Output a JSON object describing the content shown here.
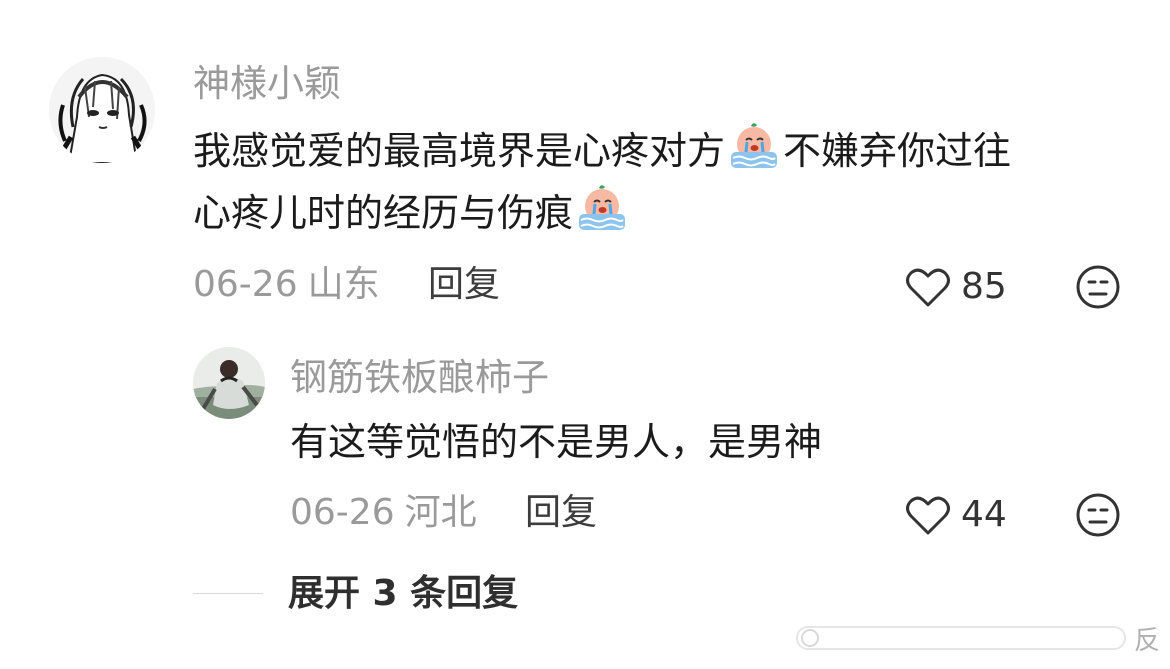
{
  "comment": {
    "username": "神様小颖",
    "text_line1": "我感觉爱的最高境界是心疼对方",
    "text_line1_tail": "不嫌弃你过往",
    "text_line2": "心疼儿时的经历与伤痕",
    "emoji_name": "crying-face-emoji",
    "date": "06-26",
    "location": "山东",
    "reply_label": "回复",
    "like_count": "85"
  },
  "reply": {
    "username": "钢筋铁板酿柿子",
    "text": "有这等觉悟的不是男人，是男神",
    "date": "06-26",
    "location": "河北",
    "reply_label": "回复",
    "like_count": "44"
  },
  "expand_label": "展开 3 条回复",
  "watermark_text": "反",
  "icons": {
    "like": "heart-outline-icon",
    "dislike": "neutral-face-icon"
  },
  "colors": {
    "username": "#9a9a9a",
    "text": "#1b1b1b",
    "meta": "#9a9a9a",
    "emoji_face": "#f7b9a4",
    "emoji_blanket": "#8cc4ee"
  }
}
